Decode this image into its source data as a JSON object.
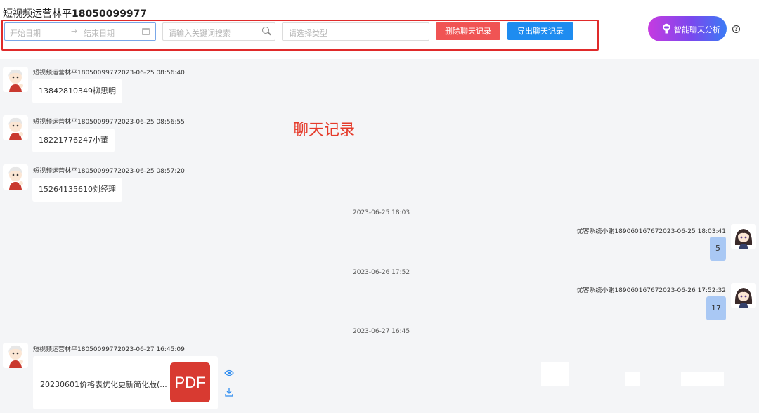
{
  "header": {
    "title_prefix": "短视频运营林平",
    "title_number": "18050099977",
    "start_date_placeholder": "开始日期",
    "date_arrow": "→",
    "end_date_placeholder": "结束日期",
    "search_placeholder": "请输入关键词搜索",
    "type_placeholder": "请选择类型",
    "delete_button": "删除聊天记录",
    "export_button": "导出聊天记录",
    "ai_button": "智能聊天分析",
    "help": "?"
  },
  "annotation": "聊天记录",
  "messages": [
    {
      "meta": "短视频运营林平180500997720​23-06-25 08:56:40",
      "text": "13842810349柳思明"
    },
    {
      "meta": "短视频运营林平180500997720​23-06-25 08:56:55",
      "text": "18221776247小董"
    },
    {
      "meta": "短视频运营林平180500997720​23-06-25 08:57:20",
      "text": "15264135610刘经理"
    }
  ],
  "separators": [
    "2023-06-25 18:03",
    "2023-06-26 17:52",
    "2023-06-27 16:45"
  ],
  "replies": [
    {
      "meta": "优客系统小谢189060167672023-06-25 18:03:41",
      "text": "5"
    },
    {
      "meta": "优客系统小谢189060167672023-06-26 17:52:32",
      "text": "17"
    }
  ],
  "file_message": {
    "meta": "短视频运营林平180500997720​23-06-27 16:45:09",
    "file_name": "20230601价格表优化更新简化版(...",
    "file_type": "PDF"
  },
  "colors": {
    "delete": "#f05454",
    "export": "#1e8cf0",
    "annotation": "#e53a2a",
    "reply_bubble": "#a9c8f4"
  },
  "icons": [
    "calendar-icon",
    "search-icon",
    "robot-icon",
    "help-icon",
    "preview-eye-icon",
    "download-icon",
    "avatar-boy",
    "avatar-girl"
  ]
}
